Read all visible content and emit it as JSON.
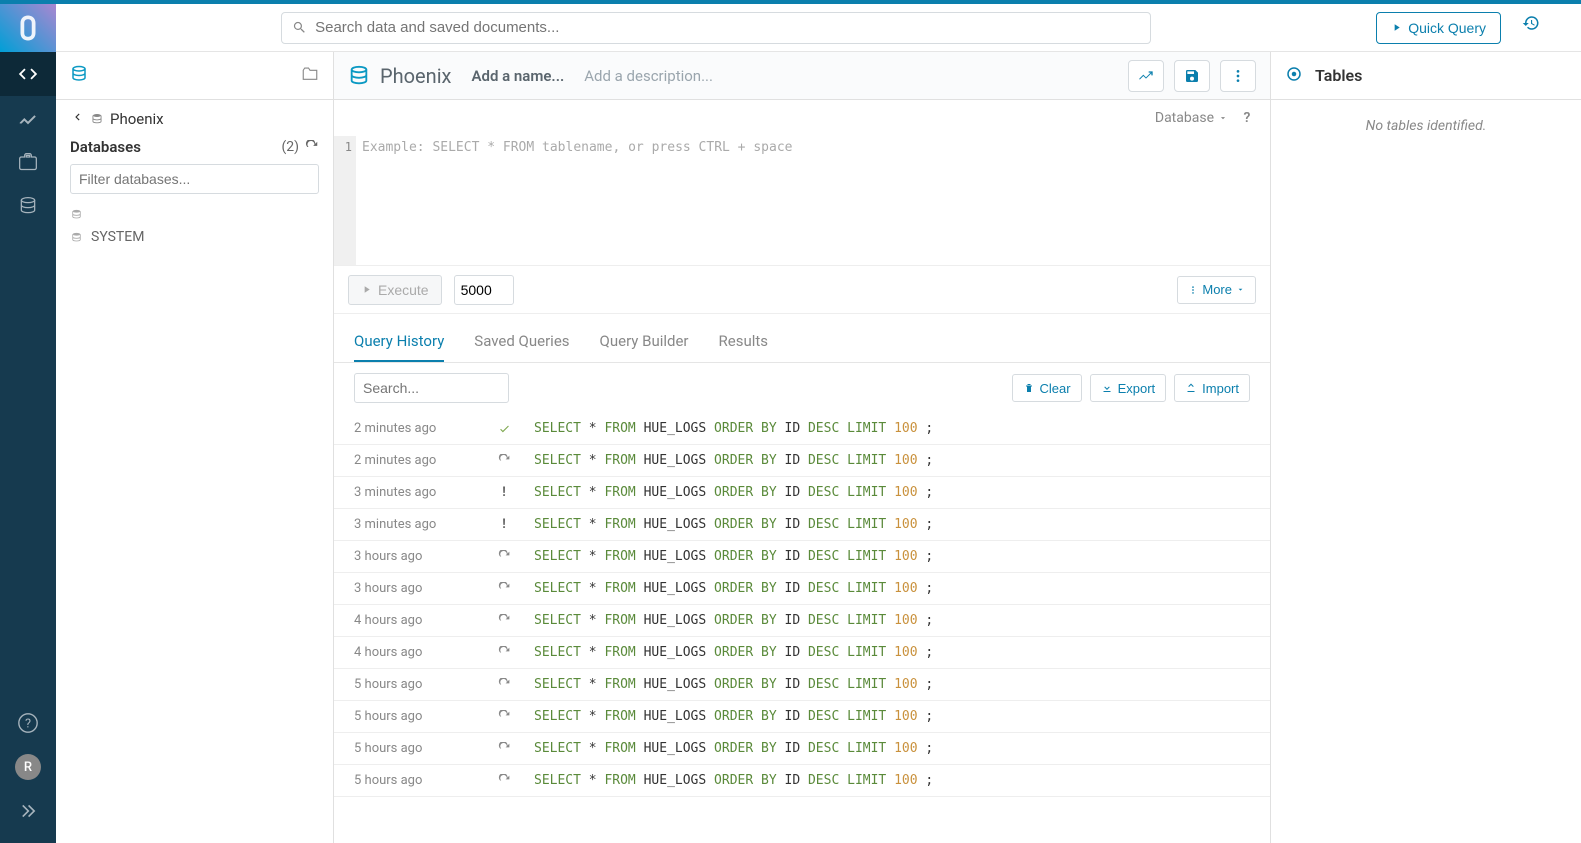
{
  "topbar": {
    "search_placeholder": "Search data and saved documents...",
    "quick_query": "Quick Query"
  },
  "nav": {
    "avatar_initial": "R"
  },
  "side": {
    "breadcrumb": "Phoenix",
    "databases_label": "Databases",
    "databases_count": "(2)",
    "filter_placeholder": "Filter databases...",
    "items": [
      {
        "label": ""
      },
      {
        "label": "SYSTEM"
      }
    ]
  },
  "center": {
    "title": "Phoenix",
    "add_name": "Add a name...",
    "add_desc": "Add a description...",
    "database_label": "Database",
    "editor_placeholder": "Example: SELECT * FROM tablename, or press CTRL + space",
    "line_no": "1",
    "execute": "Execute",
    "limit": "5000",
    "more": "More",
    "tabs": [
      "Query History",
      "Saved Queries",
      "Query Builder",
      "Results"
    ],
    "hist_search_placeholder": "Search...",
    "clear": "Clear",
    "export": "Export",
    "import": "Import"
  },
  "history": [
    {
      "time": "2 minutes ago",
      "status": "ok"
    },
    {
      "time": "2 minutes ago",
      "status": "running"
    },
    {
      "time": "3 minutes ago",
      "status": "error"
    },
    {
      "time": "3 minutes ago",
      "status": "error"
    },
    {
      "time": "3 hours ago",
      "status": "running"
    },
    {
      "time": "3 hours ago",
      "status": "running"
    },
    {
      "time": "4 hours ago",
      "status": "running"
    },
    {
      "time": "4 hours ago",
      "status": "running"
    },
    {
      "time": "5 hours ago",
      "status": "running"
    },
    {
      "time": "5 hours ago",
      "status": "running"
    },
    {
      "time": "5 hours ago",
      "status": "running"
    },
    {
      "time": "5 hours ago",
      "status": "running"
    }
  ],
  "sql": {
    "select": "SELECT",
    "star": "*",
    "from": "FROM",
    "table": "HUE_LOGS",
    "order": "ORDER",
    "by": "BY",
    "id": "ID",
    "desc": "DESC",
    "limit": "LIMIT",
    "num": "100",
    "semi": ";"
  },
  "right": {
    "title": "Tables",
    "empty": "No tables identified."
  }
}
